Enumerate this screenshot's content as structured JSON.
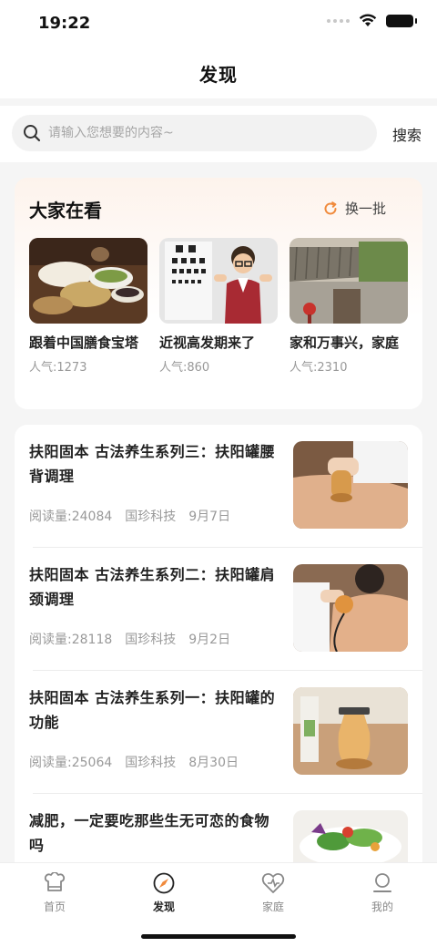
{
  "status_bar": {
    "time": "19:22"
  },
  "nav": {
    "title": "发现"
  },
  "search": {
    "placeholder": "请输入您想要的内容~",
    "button_label": "搜索"
  },
  "trending": {
    "title": "大家在看",
    "refresh_label": "换一批",
    "items": [
      {
        "title": "跟着中国膳食宝塔",
        "popularity": "人气:1273"
      },
      {
        "title": "近视高发期来了",
        "popularity": "人气:860"
      },
      {
        "title": "家和万事兴，家庭",
        "popularity": "人气:2310"
      }
    ]
  },
  "articles": [
    {
      "title": "扶阳固本 古法养生系列三：扶阳罐腰背调理",
      "reads": "阅读量:24084",
      "source": "国珍科技",
      "date": "9月7日"
    },
    {
      "title": "扶阳固本 古法养生系列二：扶阳罐肩颈调理",
      "reads": "阅读量:28118",
      "source": "国珍科技",
      "date": "9月2日"
    },
    {
      "title": "扶阳固本 古法养生系列一：扶阳罐的功能",
      "reads": "阅读量:25064",
      "source": "国珍科技",
      "date": "8月30日"
    },
    {
      "title": "减肥，一定要吃那些生无可恋的食物吗",
      "reads": "",
      "source": "",
      "date": ""
    }
  ],
  "tabs": [
    {
      "label": "首页",
      "icon": "home-icon"
    },
    {
      "label": "发现",
      "icon": "discover-icon"
    },
    {
      "label": "家庭",
      "icon": "family-icon"
    },
    {
      "label": "我的",
      "icon": "profile-icon"
    }
  ],
  "colors": {
    "accent": "#f08a3c",
    "background": "#f5f5f5",
    "muted_text": "#999999"
  }
}
